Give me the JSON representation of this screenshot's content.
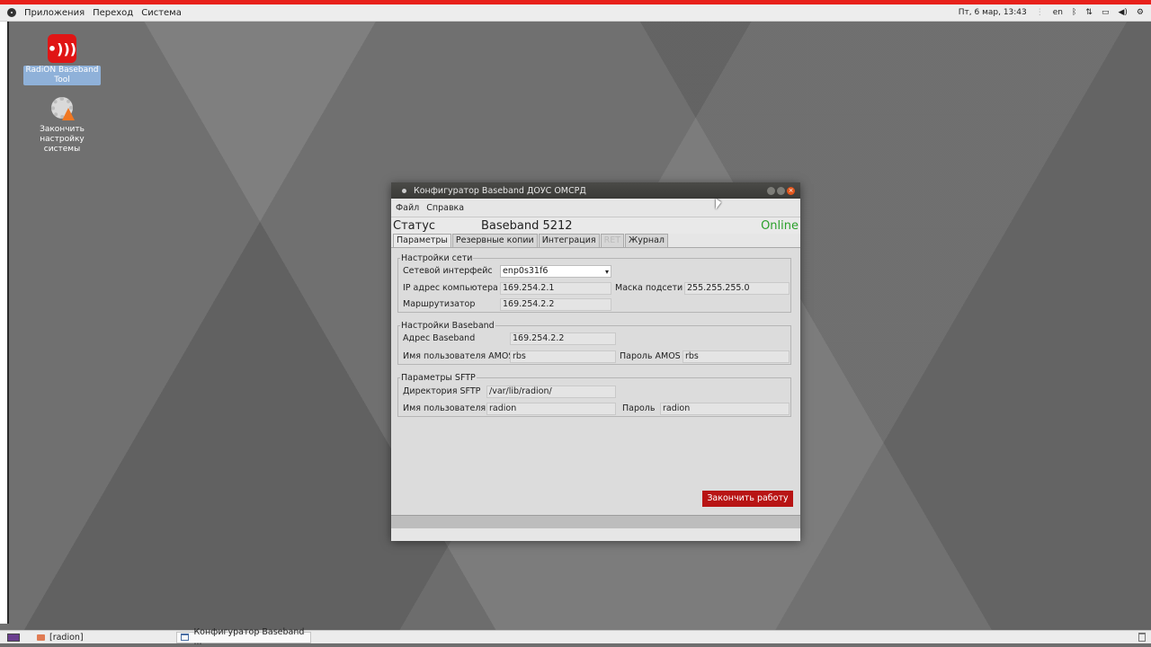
{
  "top_panel": {
    "menus": [
      "Приложения",
      "Переход",
      "Система"
    ],
    "clock": "Пт, 6 мар, 13:43",
    "keyboard_layout": "en"
  },
  "desktop_icons": [
    {
      "label": "RadiON Baseband Tool",
      "icon": "radion-icon"
    },
    {
      "label": "Закончить настройку системы",
      "icon": "gear-icon"
    }
  ],
  "window": {
    "title": "Конфигуратор Baseband ДОУС ОМСРД",
    "menu": [
      "Файл",
      "Справка"
    ],
    "status_label": "Статус",
    "device": "Baseband 5212",
    "online": "Online",
    "tabs": [
      {
        "label": "Параметры",
        "active": true
      },
      {
        "label": "Резервные копии"
      },
      {
        "label": "Интеграция"
      },
      {
        "label": "RET",
        "disabled": true
      },
      {
        "label": "Журнал"
      }
    ],
    "network": {
      "legend": "Настройки сети",
      "interface_label": "Сетевой интерфейс",
      "interface_value": "enp0s31f6",
      "ip_label": "IP адрес компьютера",
      "ip_value": "169.254.2.1",
      "mask_label": "Маска подсети",
      "mask_value": "255.255.255.0",
      "router_label": "Маршрутизатор",
      "router_value": "169.254.2.2"
    },
    "baseband": {
      "legend": "Настройки Baseband",
      "address_label": "Адрес Baseband",
      "address_value": "169.254.2.2",
      "user_label": "Имя пользователя AMOS",
      "user_value": "rbs",
      "password_label": "Пароль AMOS",
      "password_value": "rbs"
    },
    "sftp": {
      "legend": "Параметры SFTP",
      "dir_label": "Директория SFTP",
      "dir_value": "/var/lib/radion/",
      "user_label": "Имя пользователя",
      "user_value": "radion",
      "password_label": "Пароль",
      "password_value": "radion"
    },
    "finish_button": "Закончить работу"
  },
  "taskbar": {
    "tasks": [
      "[radion]",
      "Конфигуратор Baseband ..."
    ]
  }
}
